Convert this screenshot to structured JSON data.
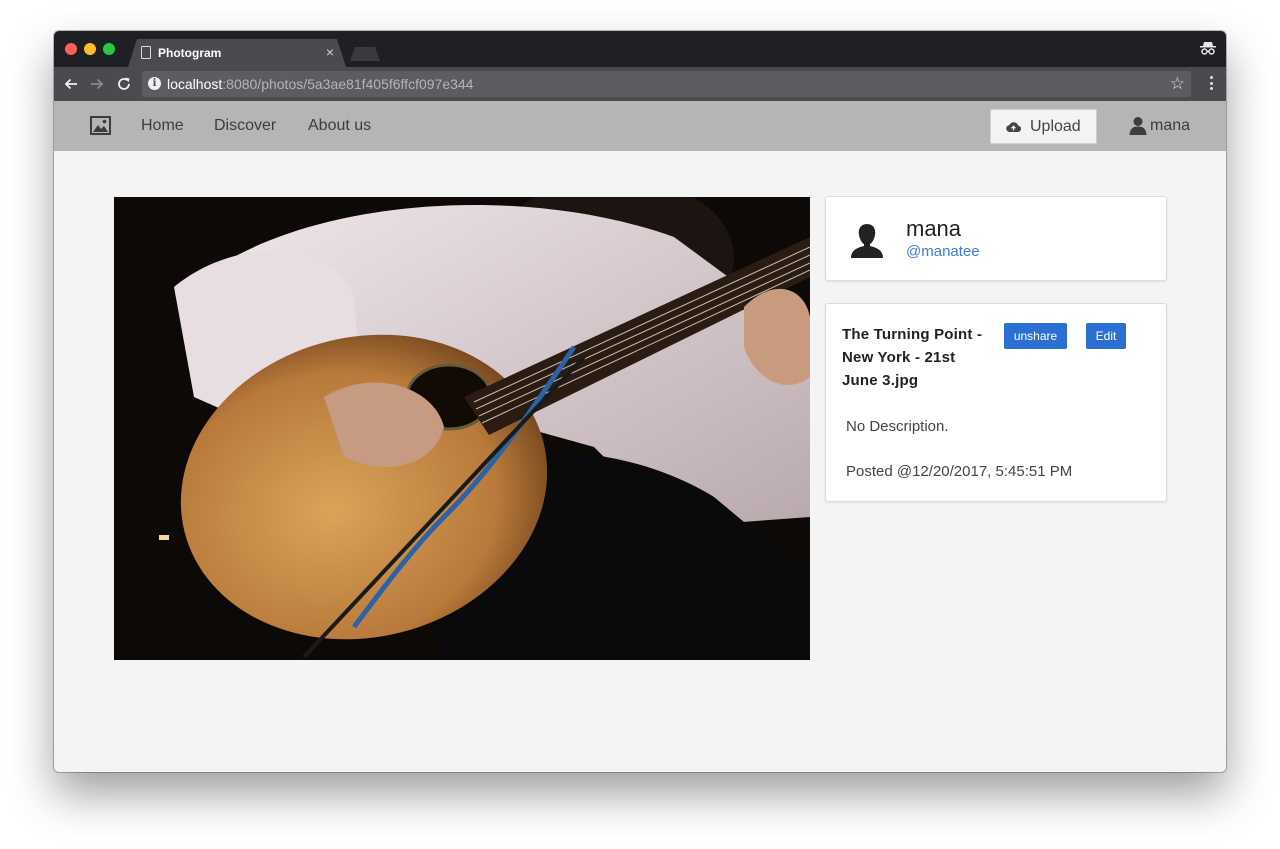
{
  "browser": {
    "tab_title": "Photogram",
    "tab_close": "×",
    "url_host": "localhost",
    "url_rest": ":8080/photos/5a3ae81f405f6ffcf097e344",
    "info_icon": "i",
    "star_icon": "☆"
  },
  "nav": {
    "logo_icon": "image-icon",
    "home": "Home",
    "discover": "Discover",
    "about": "About us",
    "upload": "Upload",
    "user": "mana"
  },
  "profile": {
    "name": "mana",
    "handle": "@manatee"
  },
  "photo": {
    "title": "The Turning Point - New York - 21st June 3.jpg",
    "unshare_label": "unshare",
    "edit_label": "Edit",
    "description": "No Description.",
    "posted": "Posted @12/20/2017, 5:45:51 PM"
  },
  "colors": {
    "nav_bg": "#b5b5b5",
    "page_bg": "#f4f4f4",
    "accent": "#2a6fd1",
    "link": "#3e7bd4"
  }
}
